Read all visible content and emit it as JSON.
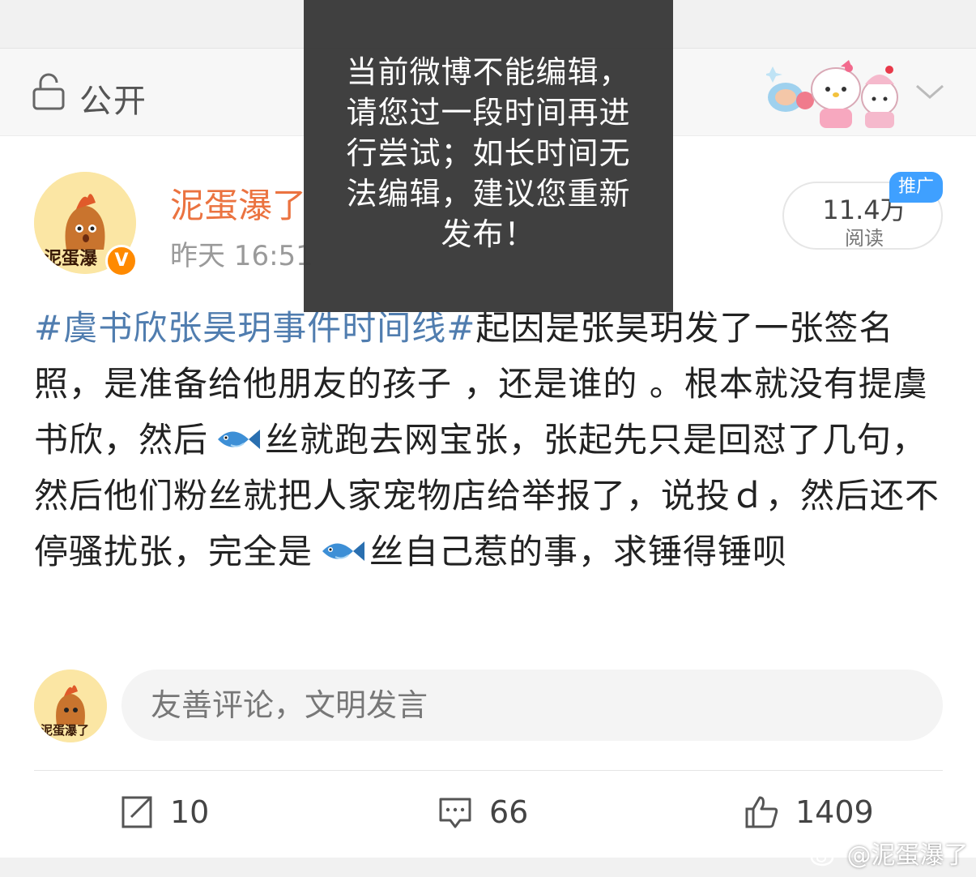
{
  "privacy": {
    "label": "公开"
  },
  "post": {
    "user_name": "泥蛋瀑了",
    "avatar_text": "泥蛋瀑",
    "time": "昨天 16:51",
    "verified": "V",
    "hashtag": "#虞书欣张昊玥事件时间线#",
    "text_part1": "起因是张昊玥发了一张签名照，是准备给他朋友的孩子 ，还是谁的 。根本就没有提虞书欣，然后",
    "text_part2": "丝就跑去网宝张，张起先只是回怼了几句，然后他们粉丝就把人家宠物店给举报了，说投ｄ，然后还不停骚扰张，完全是",
    "text_part3": "丝自己惹的事，求锤得锤呗",
    "fish_emoji": "fish-icon"
  },
  "stats": {
    "read_count": "11.4万",
    "read_label": "阅读",
    "promo_label": "推广"
  },
  "comment": {
    "avatar_text": "泥蛋瀑了",
    "placeholder": "友善评论，文明发言"
  },
  "actions": {
    "repost_count": "10",
    "comment_count": "66",
    "like_count": "1409"
  },
  "toast": {
    "message": "当前微博不能编辑，请您过一段时间再进行尝试；如长时间无法编辑，建议您重新发布！"
  },
  "watermark": {
    "text": "@泥蛋瀑了"
  },
  "colors": {
    "name": "#eb7340",
    "hashtag": "#507daf",
    "verified": "#ff8a00",
    "promo": "#3fa0ff",
    "toast_bg": "#3a3a3a"
  }
}
